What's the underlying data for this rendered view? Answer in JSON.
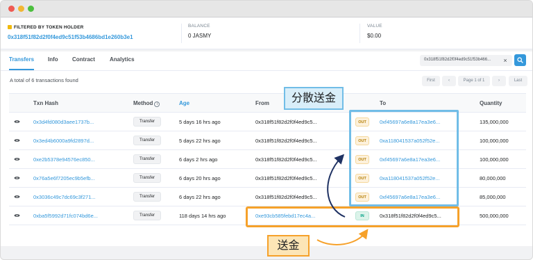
{
  "filter": {
    "label": "FILTERED BY TOKEN HOLDER",
    "address": "0x318f51f82d2f0f4ed9c51f53b4686bd1e260b3e1",
    "balance_label": "BALANCE",
    "balance_value": "0 JASMY",
    "value_label": "VALUE",
    "value_value": "$0.00"
  },
  "tabs": [
    "Transfers",
    "Info",
    "Contract",
    "Analytics"
  ],
  "search": {
    "chip_text": "0x318f51f82d2f0f4ed9c51f53b466...",
    "close_glyph": "×"
  },
  "summary": "A total of 6 transactions found",
  "pager": {
    "first": "First",
    "prev": "‹",
    "info": "Page 1 of 1",
    "next": "›",
    "last": "Last"
  },
  "table": {
    "headers": [
      "Txn Hash",
      "Method",
      "Age",
      "From",
      "To",
      "Quantity"
    ],
    "method_info_glyph": "i",
    "rows": [
      {
        "hash": "0x3d4fd080d3aee1737b...",
        "method": "Transfer",
        "age": "5 days 16 hrs ago",
        "from": "0x318f51f82d2f0f4ed9c5...",
        "dir": "OUT",
        "to": "0xf45697a6e8a17ea3e6...",
        "qty": "135,000,000"
      },
      {
        "hash": "0x3ed4b6000a9fd2897d...",
        "method": "Transfer",
        "age": "5 days 22 hrs ago",
        "from": "0x318f51f82d2f0f4ed9c5...",
        "dir": "OUT",
        "to": "0xa118041537a052f52e...",
        "qty": "100,000,000"
      },
      {
        "hash": "0xe2b5378e94576ec850...",
        "method": "Transfer",
        "age": "6 days 2 hrs ago",
        "from": "0x318f51f82d2f0f4ed9c5...",
        "dir": "OUT",
        "to": "0xf45697a6e8a17ea3e6...",
        "qty": "100,000,000"
      },
      {
        "hash": "0x76a5e6f7205ec9b5efb...",
        "method": "Transfer",
        "age": "6 days 20 hrs ago",
        "from": "0x318f51f82d2f0f4ed9c5...",
        "dir": "OUT",
        "to": "0xa118041537a052f52e...",
        "qty": "80,000,000"
      },
      {
        "hash": "0x3036c49c7dc69c3f271...",
        "method": "Transfer",
        "age": "6 days 22 hrs ago",
        "from": "0x318f51f82d2f0f4ed9c5...",
        "dir": "OUT",
        "to": "0xf45697a6e8a17ea3e6...",
        "qty": "85,000,000"
      },
      {
        "hash": "0xba5f5992d71fc074bd6e...",
        "method": "Transfer",
        "age": "118 days 14 hrs ago",
        "from": "0xe93cb585febd17ec4a...",
        "dir": "IN",
        "to": "0x318f51f82d2f0f4ed9c5...",
        "qty": "500,000,000"
      }
    ]
  },
  "annotations": {
    "distribute_label": "分散送金",
    "send_label": "送金"
  },
  "colors": {
    "accent": "#3498db",
    "callout_blue": "#71bde7",
    "callout_orange": "#f6a12a"
  }
}
